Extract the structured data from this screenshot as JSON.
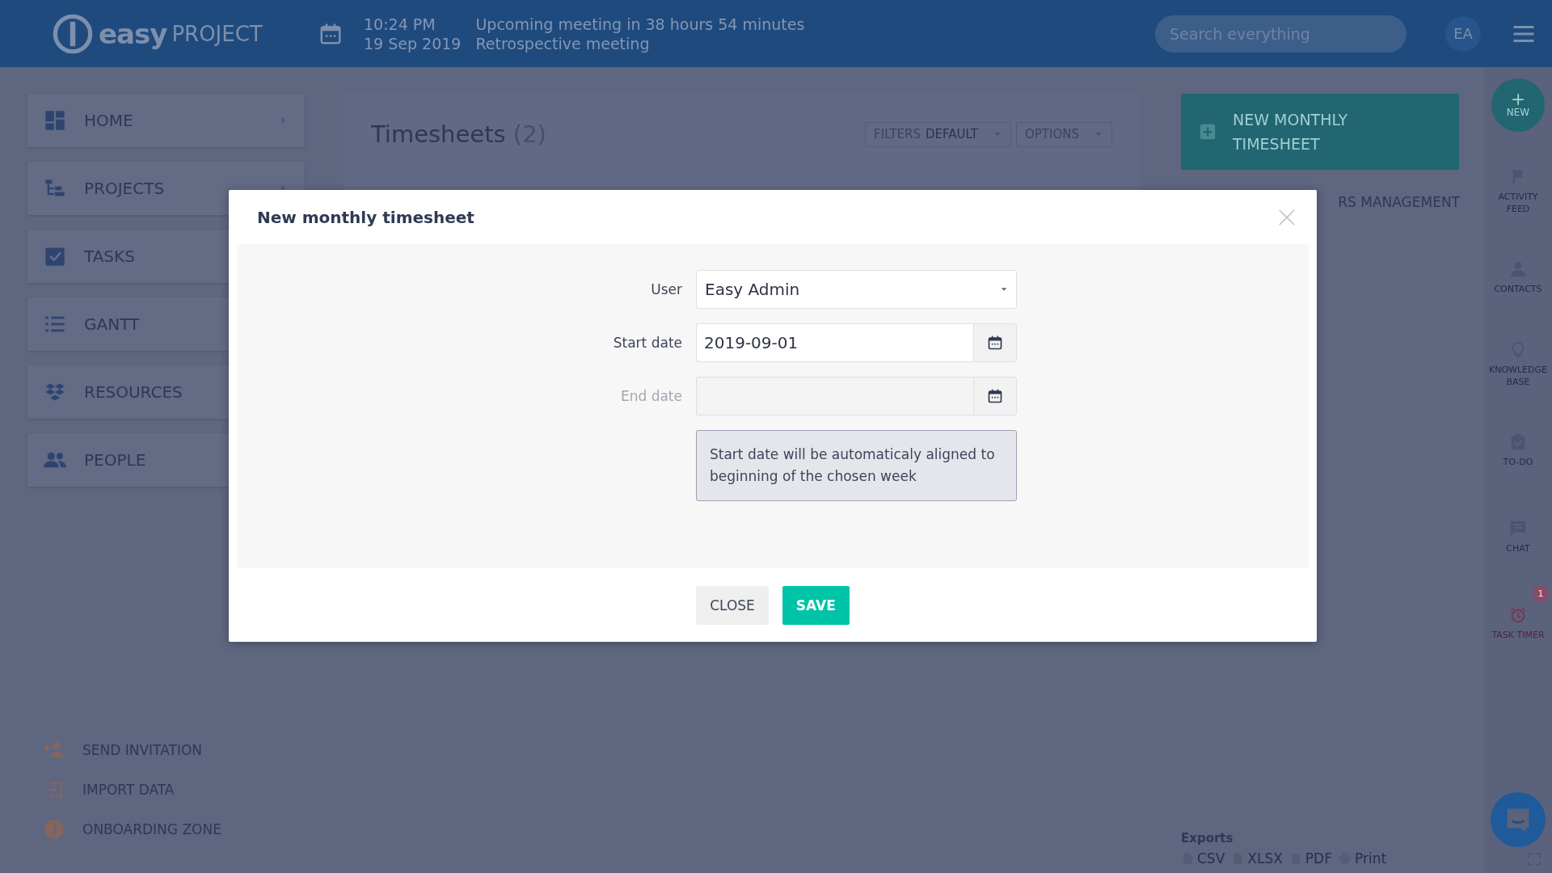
{
  "header": {
    "logo": {
      "word1": "easy",
      "word2": "PROJECT"
    },
    "reminder": {
      "time": "10:24 PM",
      "message": "Upcoming meeting in 38 hours 54 minutes",
      "date": "19 Sep 2019",
      "meeting": "Retrospective meeting"
    },
    "search": {
      "placeholder": "Search everything"
    },
    "avatar": "EA"
  },
  "nav": [
    {
      "label": "HOME",
      "arrow": true
    },
    {
      "label": "PROJECTS",
      "arrow": true
    },
    {
      "label": "TASKS"
    },
    {
      "label": "GANTT"
    },
    {
      "label": "RESOURCES"
    },
    {
      "label": "PEOPLE"
    }
  ],
  "bottom_links": [
    "SEND INVITATION",
    "IMPORT DATA",
    "ONBOARDING ZONE"
  ],
  "main": {
    "title": "Timesheets",
    "count": "(2)",
    "filters": {
      "label": "FILTERS",
      "value": "DEFAULT"
    },
    "options": "OPTIONS"
  },
  "new_button": "NEW MONTHLY TIMESHEET",
  "side_link": "RS MANAGEMENT",
  "exports": {
    "title": "Exports",
    "links": [
      "CSV",
      "XLSX",
      "PDF",
      "Print"
    ]
  },
  "right_sidebar": {
    "new_label": "NEW",
    "items": [
      {
        "label": "ACTIVITY FEED",
        "active": false
      },
      {
        "label": "CONTACTS",
        "active": false
      },
      {
        "label": "KNOWLEDGE BASE",
        "active": false
      },
      {
        "label": "TO-DO",
        "active": false
      },
      {
        "label": "CHAT",
        "active": false
      },
      {
        "label": "TASK TIMER",
        "active": true,
        "badge": "1"
      }
    ]
  },
  "modal": {
    "title": "New monthly timesheet",
    "fields": [
      {
        "label": "User",
        "kind": "select",
        "value": "Easy Admin",
        "disabled": false
      },
      {
        "label": "Start date",
        "kind": "date",
        "value": "2019-09-01",
        "disabled": false
      },
      {
        "label": "End date",
        "kind": "date",
        "disabled": true
      }
    ],
    "note": "Start date will be automaticaly aligned to beginning of the chosen week",
    "buttons": [
      {
        "label": "CLOSE",
        "kind": "secondary"
      },
      {
        "label": "SAVE",
        "kind": "primary"
      }
    ]
  }
}
